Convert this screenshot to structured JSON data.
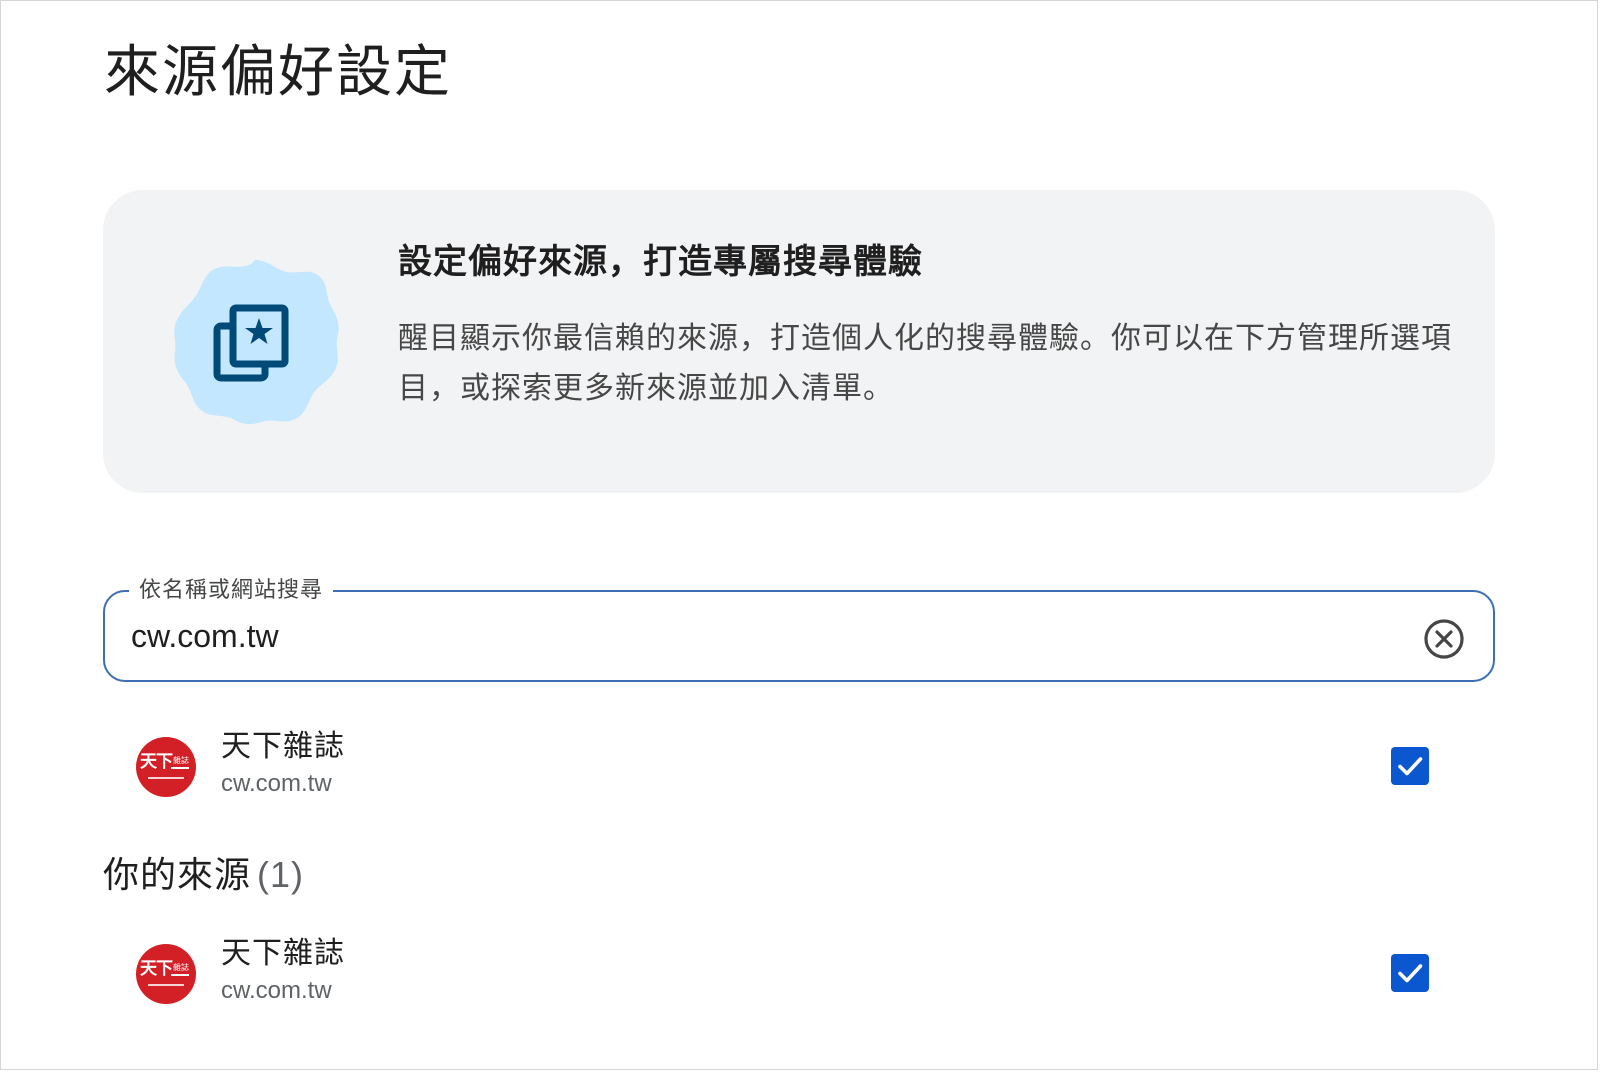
{
  "page": {
    "title": "來源偏好設定"
  },
  "info_card": {
    "icon": "star-gallery-icon",
    "heading": "設定偏好來源，打造專屬搜尋體驗",
    "body": "醒目顯示你最信賴的來源，打造個人化的搜尋體驗。你可以在下方管理所選項目，或探索更多新來源並加入清單。"
  },
  "search": {
    "label": "依名稱或網站搜尋",
    "value": "cw.com.tw",
    "clear_icon": "close-circle-icon"
  },
  "search_results": [
    {
      "name": "天下雜誌",
      "domain": "cw.com.tw",
      "checked": true
    }
  ],
  "your_sources": {
    "title": "你的來源",
    "count": "(1)",
    "items": [
      {
        "name": "天下雜誌",
        "domain": "cw.com.tw",
        "checked": true
      }
    ]
  },
  "colors": {
    "accent": "#0b57d0",
    "search_border": "#3c6fb3",
    "card_bg": "#f2f3f4",
    "badge_bg": "#c2e7ff",
    "badge_icon": "#004a77",
    "logo_red": "#d32027"
  }
}
